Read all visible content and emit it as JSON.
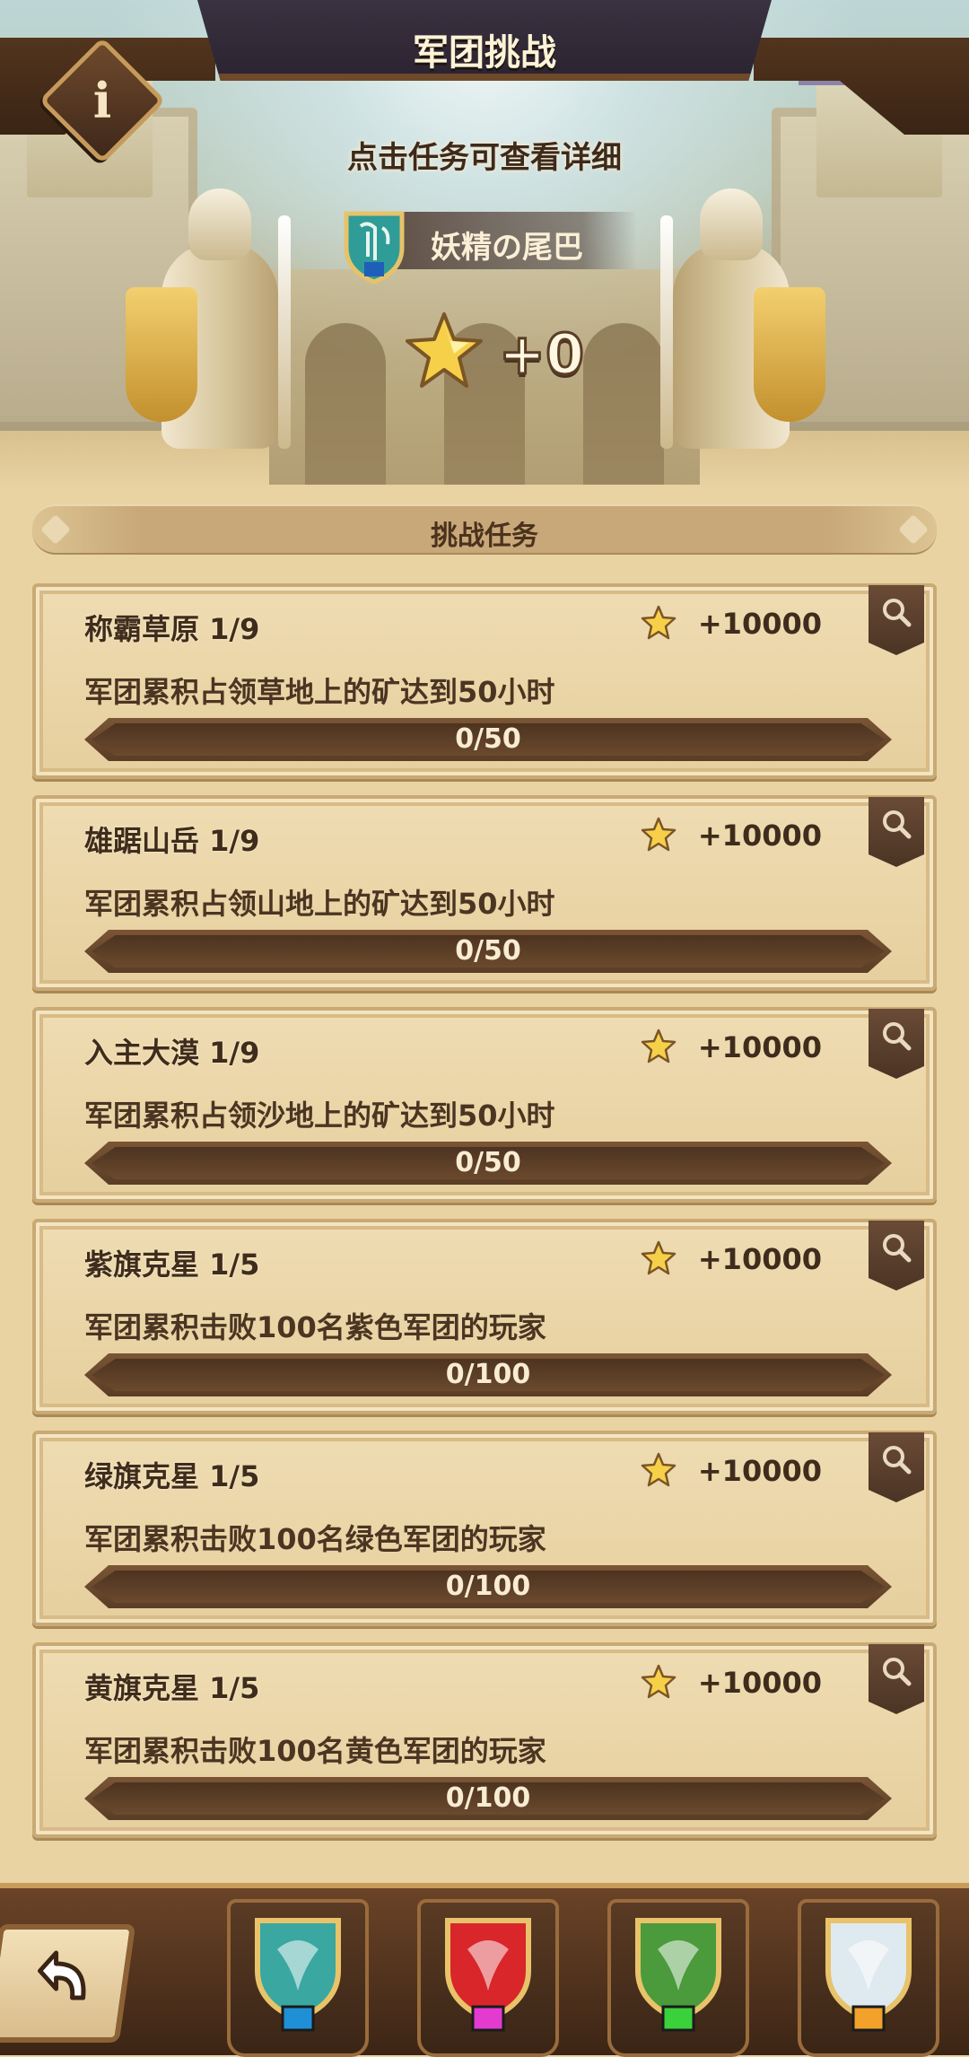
{
  "header": {
    "title": "军团挑战",
    "info_label": "i",
    "subtitle": "点击任务可查看详细"
  },
  "legion": {
    "name": "妖精の尾巴",
    "score": "+0"
  },
  "section": {
    "title": "挑战任务"
  },
  "tasks": [
    {
      "name": "称霸草原 1/9",
      "reward": "+10000",
      "desc": "军团累积占领草地上的矿达到50小时",
      "progress_text": "0/50",
      "progress": 0
    },
    {
      "name": "雄踞山岳 1/9",
      "reward": "+10000",
      "desc": "军团累积占领山地上的矿达到50小时",
      "progress_text": "0/50",
      "progress": 0
    },
    {
      "name": "入主大漠 1/9",
      "reward": "+10000",
      "desc": "军团累积占领沙地上的矿达到50小时",
      "progress_text": "0/50",
      "progress": 0
    },
    {
      "name": "紫旗克星 1/5",
      "reward": "+10000",
      "desc": "军团累积击败100名紫色军团的玩家",
      "progress_text": "0/100",
      "progress": 0
    },
    {
      "name": "绿旗克星 1/5",
      "reward": "+10000",
      "desc": "军团累积击败100名绿色军团的玩家",
      "progress_text": "0/100",
      "progress": 0
    },
    {
      "name": "黄旗克星 1/5",
      "reward": "+10000",
      "desc": "军团累积击败100名黄色军团的玩家",
      "progress_text": "0/100",
      "progress": 0
    }
  ],
  "bottom_tabs": [
    {
      "icon": "harp-shield-icon",
      "flag_color": "#1f8fd6",
      "shield_color": "#3aa7a1"
    },
    {
      "icon": "dragon-shield-icon",
      "flag_color": "#e33ad0",
      "shield_color": "#d8262b"
    },
    {
      "icon": "leaf-shield-icon",
      "flag_color": "#3bd13b",
      "shield_color": "#4b9a3c"
    },
    {
      "icon": "trident-shield-icon",
      "flag_color": "#f2a12a",
      "shield_color": "#dfe9f0"
    }
  ],
  "icons": {
    "info": "info-icon",
    "star": "star-icon",
    "search": "search-icon",
    "back": "back-arrow-icon"
  },
  "colors": {
    "accent_gold": "#f2c24a",
    "dark_wood": "#4b3424",
    "parchment": "#e9d3a2"
  }
}
